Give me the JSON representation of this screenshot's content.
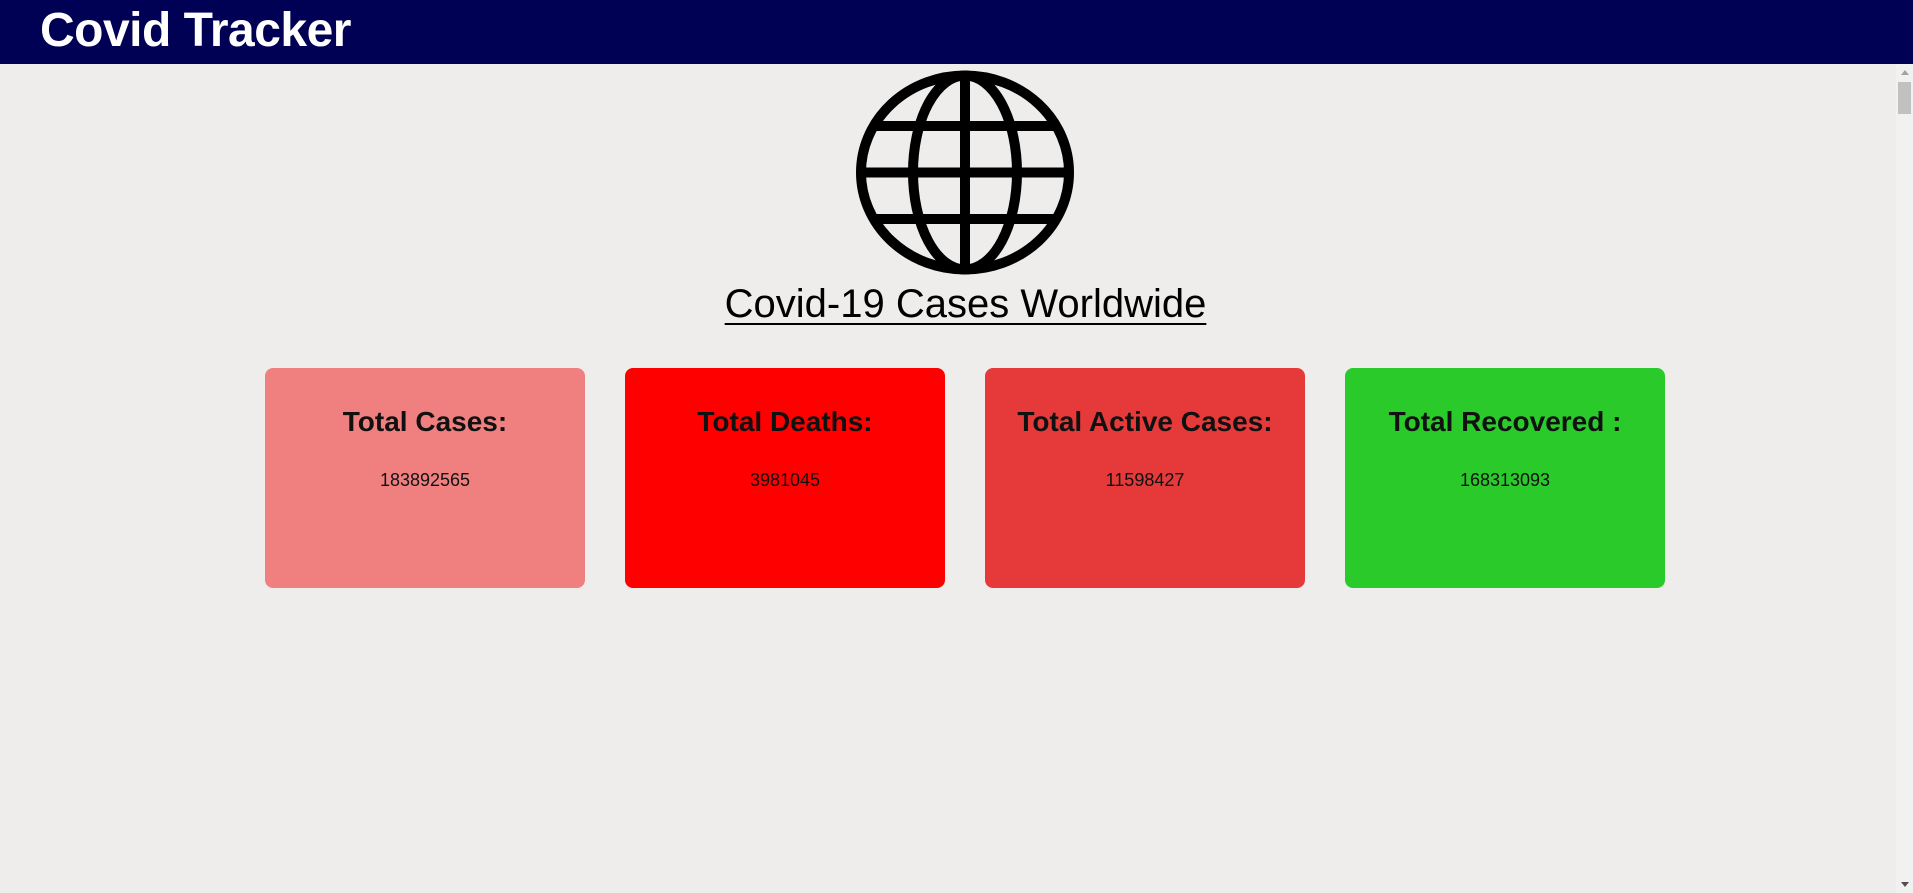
{
  "navbar": {
    "brand": "Covid Tracker",
    "background": "#000055"
  },
  "main": {
    "icon": "globe-icon",
    "heading": "Covid-19 Cases Worldwide"
  },
  "cards": [
    {
      "id": "cases",
      "title": "Total Cases:",
      "value": "183892565",
      "color": "#f08080"
    },
    {
      "id": "deaths",
      "title": "Total Deaths:",
      "value": "3981045",
      "color": "#ff0000"
    },
    {
      "id": "active",
      "title": "Total Active Cases:",
      "value": "11598427",
      "color": "#e63a3a"
    },
    {
      "id": "recovered",
      "title": "Total Recovered :",
      "value": "168313093",
      "color": "#2bca2b"
    }
  ]
}
